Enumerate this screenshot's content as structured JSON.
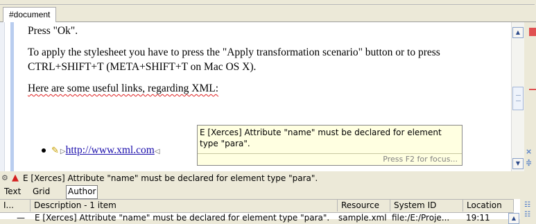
{
  "breadcrumb": {
    "label": "#document"
  },
  "editor": {
    "paragraphs": [
      "Press \"Ok\".",
      "To apply the stylesheet you have to press the \"Apply transformation scenario\" button or to press CTRL+SHIFT+T (META+SHIFT+T on Mac OS X).",
      "Here are some useful links, regarding XML:"
    ],
    "bullet_link": "http://www.xml.com",
    "bullet_end_marker": "◁"
  },
  "tooltip": {
    "message": "E [Xerces] Attribute \"name\" must be declared for element type \"para\".",
    "hint": "Press F2 for focus..."
  },
  "status": {
    "message": "E [Xerces] Attribute \"name\" must be declared for element type \"para\"."
  },
  "modes": {
    "tabs": [
      "Text",
      "Grid",
      "Author"
    ],
    "active": "Author"
  },
  "problems": {
    "columns": [
      "I...",
      "Description - 1 item",
      "Resource",
      "System ID",
      "Location"
    ],
    "rows": [
      {
        "icon": "—",
        "description": "E [Xerces] Attribute \"name\" must be declared for element type \"para\".",
        "resource": "sample.xml",
        "system_id": "file:/E:/Proje...",
        "location": "19:11"
      }
    ]
  },
  "icons": {
    "warning": "warning-triangle-icon",
    "pencil": "pencil-icon",
    "gear": "gear-icon"
  },
  "colors": {
    "error": "#d42020",
    "tooltip_bg": "#ffffe1",
    "link": "#1a0dab"
  }
}
